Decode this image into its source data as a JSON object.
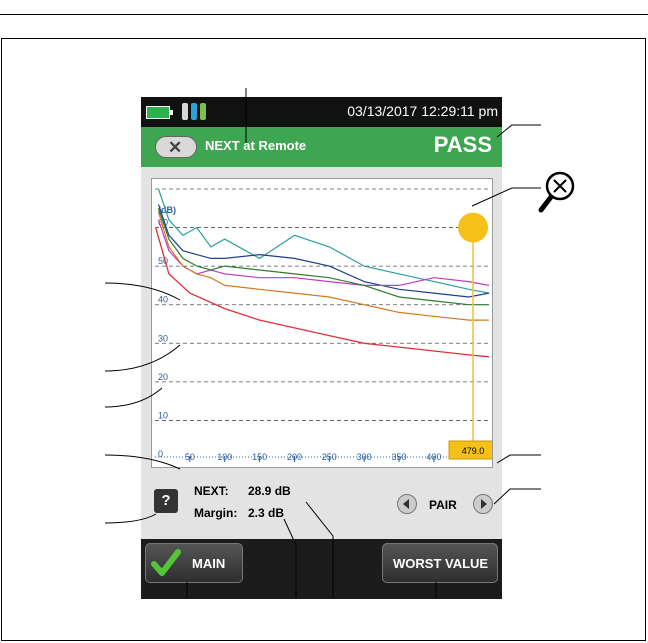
{
  "status": {
    "datetime": "03/13/2017 12:29:11 pm"
  },
  "header": {
    "back_icon": "x-icon",
    "title": "NEXT at Remote",
    "result": "PASS",
    "result_color": "#3ea650"
  },
  "chart_data": {
    "type": "line",
    "ylabel": "(dB)",
    "x_ticks": [
      "50",
      "100",
      "150",
      "200",
      "250",
      "300",
      "350",
      "400"
    ],
    "y_ticks": [
      "0",
      "10",
      "20",
      "30",
      "40",
      "50",
      "60"
    ],
    "xlim": [
      0,
      479
    ],
    "ylim": [
      0,
      70
    ],
    "cursor_value": "479.0",
    "limit_line": {
      "x": [
        1,
        20,
        50,
        100,
        150,
        200,
        250,
        300,
        350,
        400,
        450,
        479
      ],
      "y": [
        60,
        48,
        43,
        39,
        36,
        34,
        32,
        30,
        29,
        28,
        27,
        26.5
      ]
    },
    "series": [
      {
        "color": "#2aa198",
        "x": [
          5,
          20,
          40,
          60,
          80,
          100,
          150,
          200,
          250,
          300,
          350,
          400,
          450,
          479
        ],
        "y": [
          70,
          62,
          58,
          60,
          55,
          57,
          52,
          58,
          55,
          50,
          48,
          46,
          44,
          43
        ]
      },
      {
        "color": "#1f3f8f",
        "x": [
          5,
          20,
          40,
          60,
          80,
          100,
          150,
          200,
          250,
          300,
          350,
          400,
          450,
          479
        ],
        "y": [
          66,
          58,
          54,
          53,
          52,
          52,
          53,
          52,
          50,
          46,
          44,
          43,
          42,
          43
        ]
      },
      {
        "color": "#c03cc0",
        "x": [
          5,
          20,
          40,
          60,
          80,
          100,
          150,
          200,
          250,
          300,
          350,
          400,
          450,
          479
        ],
        "y": [
          62,
          54,
          50,
          48,
          49,
          48,
          47,
          47,
          46,
          45,
          45,
          47,
          46,
          45
        ]
      },
      {
        "color": "#d27a1e",
        "x": [
          5,
          20,
          40,
          60,
          80,
          100,
          150,
          200,
          250,
          300,
          350,
          400,
          450,
          479
        ],
        "y": [
          64,
          55,
          50,
          48,
          47,
          45,
          44,
          43,
          42,
          40,
          38,
          37,
          36,
          36
        ]
      },
      {
        "color": "#2e7d32",
        "x": [
          5,
          20,
          40,
          60,
          80,
          100,
          150,
          200,
          250,
          300,
          350,
          400,
          450,
          479
        ],
        "y": [
          65,
          57,
          52,
          50,
          49,
          50,
          49,
          48,
          47,
          45,
          42,
          41,
          40,
          40
        ]
      }
    ]
  },
  "info": {
    "next_label": "NEXT:",
    "next_value": "28.9 dB",
    "margin_label": "Margin:",
    "margin_value": "2.3 dB"
  },
  "pair_label": "PAIR",
  "help_label": "?",
  "softkeys": {
    "main": "MAIN",
    "worst": "WORST VALUE"
  },
  "icons": {
    "zoom": "zoom-out-icon",
    "check": "check-icon"
  }
}
